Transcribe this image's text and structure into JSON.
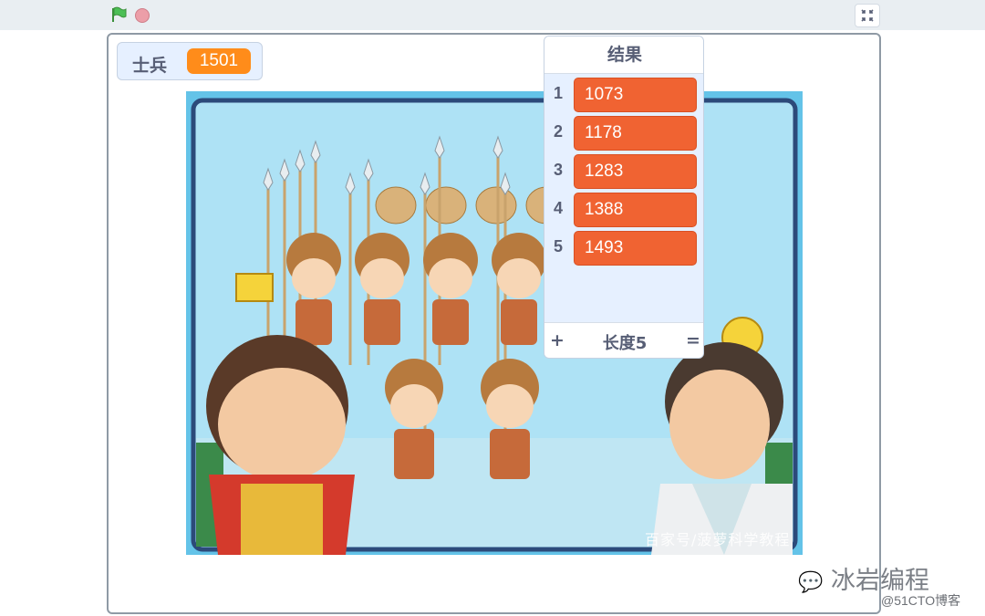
{
  "toolbar": {
    "green_flag_icon": "green-flag-icon",
    "stop_icon": "stop-sign-icon",
    "fullscreen_icon": "exit-fullscreen-icon"
  },
  "variable_monitor": {
    "label": "士兵",
    "value": "1501"
  },
  "list_monitor": {
    "title": "结果",
    "items": [
      {
        "index": "1",
        "value": "1073"
      },
      {
        "index": "2",
        "value": "1178"
      },
      {
        "index": "3",
        "value": "1283"
      },
      {
        "index": "4",
        "value": "1388"
      },
      {
        "index": "5",
        "value": "1493"
      }
    ],
    "add_label": "+",
    "length_label": "长度5",
    "resize_label": "="
  },
  "scene": {
    "watermark": "百家号/菠萝科学教程"
  },
  "branding": {
    "logo_text": "冰岩编程",
    "sub_text": "@51CTO博客"
  },
  "colors": {
    "variable_value_bg": "#ff8c1a",
    "list_item_bg": "#f06332",
    "monitor_bg": "#e6f0ff",
    "label_text": "#575e75"
  }
}
